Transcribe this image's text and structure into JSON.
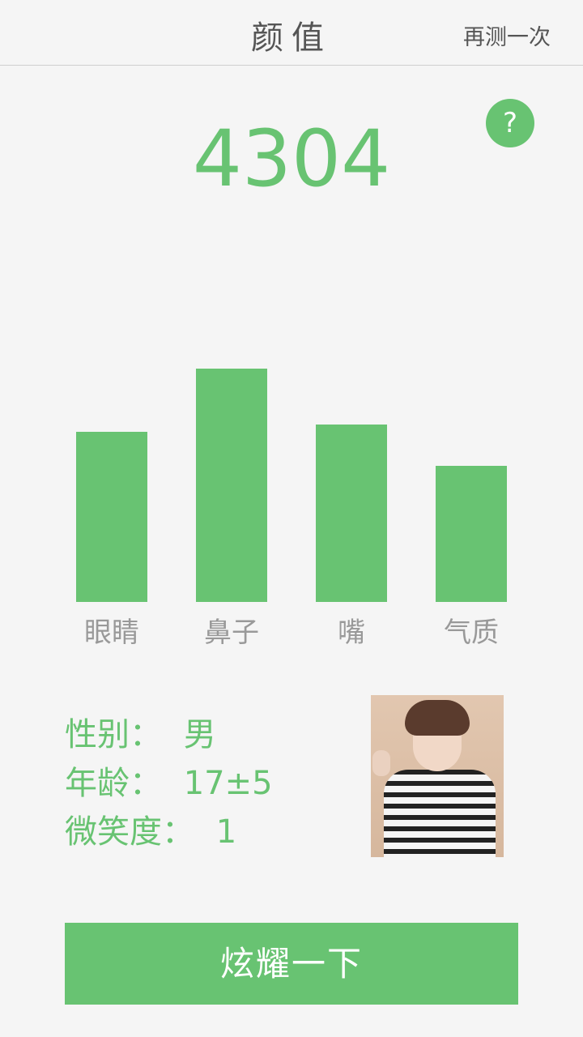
{
  "header": {
    "title": "颜值",
    "retest_label": "再测一次"
  },
  "help": {
    "label": "?",
    "icon": "question-icon"
  },
  "score": {
    "value": "4304"
  },
  "chart_data": {
    "type": "bar",
    "categories": [
      "眼睛",
      "鼻子",
      "嘴",
      "气质"
    ],
    "values": [
      70,
      96,
      73,
      56
    ],
    "ylim": [
      0,
      100
    ],
    "color": "#68c372"
  },
  "info": {
    "gender_label": "性别：",
    "gender_value": "男",
    "age_label": "年龄：",
    "age_value": "17±5",
    "smile_label": "微笑度：",
    "smile_value": "1"
  },
  "share_button": {
    "label": "炫耀一下"
  },
  "colors": {
    "accent": "#68c372",
    "title_text": "#555555",
    "axis_label": "#999999"
  }
}
